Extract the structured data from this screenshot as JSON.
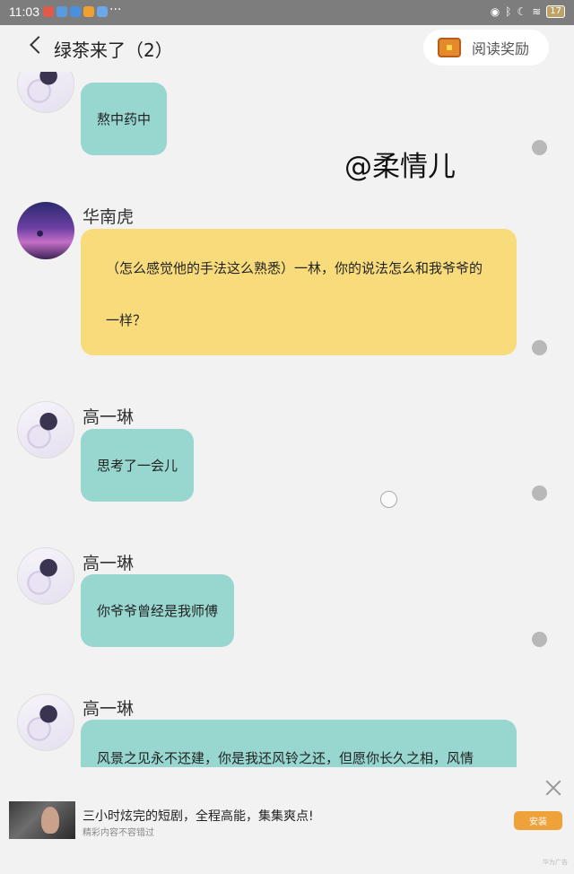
{
  "status_bar": {
    "time": "11:03",
    "more": "···",
    "battery": "17"
  },
  "header": {
    "back_label": "",
    "title": "绿茶来了（2）",
    "reward_label": "阅读奖励"
  },
  "watermark": "@柔情儿",
  "messages": [
    {
      "sender": "",
      "avatar": "girl-avatar",
      "text": "熬中药中",
      "color": "teal"
    },
    {
      "sender": "华南虎",
      "avatar": "dusk-avatar",
      "text_lines": [
        "（怎么感觉他的手法这么熟悉）一林，你的说法怎么和我爷爷的",
        "一样？"
      ],
      "color": "yellow"
    },
    {
      "sender": "高一琳",
      "avatar": "girl-avatar",
      "text": "思考了一会儿",
      "color": "teal"
    },
    {
      "sender": "高一琳",
      "avatar": "girl-avatar",
      "text": "你爷爷曾经是我师傅",
      "color": "teal"
    },
    {
      "sender": "高一琳",
      "avatar": "girl-avatar",
      "text": "风景之见永不还建，你是我还风铃之还，但愿你长久之相，风情",
      "color": "teal"
    }
  ],
  "ad": {
    "title": "三小时炫完的短剧，全程高能，集集爽点!",
    "subtitle": "精彩内容不容错过",
    "button": "安装",
    "tag": "华为广告"
  },
  "colors": {
    "teal_bubble": "#97d7d0",
    "yellow_bubble": "#f8dc7c",
    "background": "#f2f2f2",
    "ad_button": "#f0a23a"
  }
}
